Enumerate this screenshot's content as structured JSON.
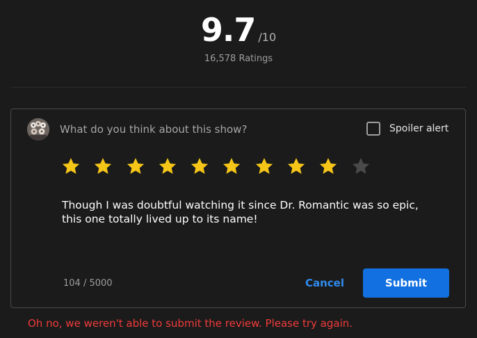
{
  "rating": {
    "score": "9.7",
    "max": "/10",
    "count_text": "16,578 Ratings"
  },
  "review_form": {
    "avatar_icon": "user-avatar",
    "prompt": "What do you think about this show?",
    "spoiler_label": "Spoiler alert",
    "spoiler_checked": false,
    "stars_total": 10,
    "stars_selected": 9,
    "star_icon": "star-icon",
    "colors": {
      "star_filled": "#f5c518",
      "star_empty": "#4a4a4a",
      "accent": "#1270e0",
      "link": "#2f8cf0",
      "error": "#f23b3b"
    },
    "review_text": "Though I was doubtful watching it since Dr. Romantic was so epic,\nthis one totally lived up to its name!",
    "char_count": "104 / 5000",
    "cancel_label": "Cancel",
    "submit_label": "Submit"
  },
  "error_message": "Oh no, we weren't able to submit the review. Please try again."
}
